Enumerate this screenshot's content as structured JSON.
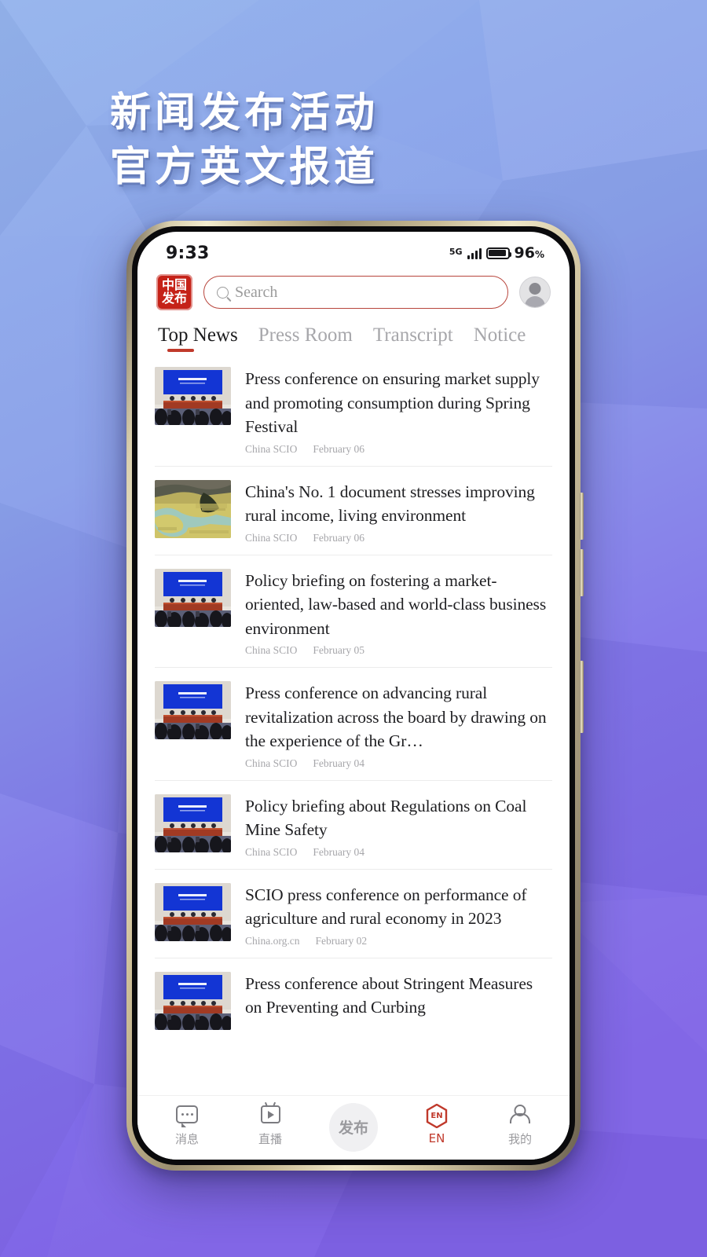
{
  "poster": {
    "headline_line1": "新闻发布活动",
    "headline_line2": "官方英文报道",
    "bg_top_color": "#8fb0ea",
    "bg_bottom_color": "#8067e6"
  },
  "status_bar": {
    "time": "9:33",
    "network": "5G",
    "battery_percent": "96",
    "percent_symbol": "%"
  },
  "header": {
    "logo_line1": "中国",
    "logo_line2": "发布",
    "search_placeholder": "Search",
    "search_value": "",
    "avatar_name": "user-avatar",
    "accent_color": "#c52218"
  },
  "tabs": [
    {
      "label": "Top News",
      "active": true
    },
    {
      "label": "Press Room",
      "active": false
    },
    {
      "label": "Transcript",
      "active": false
    },
    {
      "label": "Notice",
      "active": false
    }
  ],
  "news": [
    {
      "title": "Press conference on ensuring market supply and promoting consumption during Spring Festival",
      "source": "China SCIO",
      "date": "February 06",
      "thumb": "press-conference"
    },
    {
      "title": "China's No. 1 document stresses improving rural income, living environment",
      "source": "China SCIO",
      "date": "February 06",
      "thumb": "rural-landscape"
    },
    {
      "title": "Policy briefing on fostering a market-oriented, law-based and world-class business environment",
      "source": "China SCIO",
      "date": "February 05",
      "thumb": "press-conference"
    },
    {
      "title": "Press conference on advancing rural revitalization across the board by drawing on the experience of the Gr…",
      "source": "China SCIO",
      "date": "February 04",
      "thumb": "press-conference"
    },
    {
      "title": "Policy briefing about Regulations on Coal Mine Safety",
      "source": "China SCIO",
      "date": "February 04",
      "thumb": "press-conference"
    },
    {
      "title": "SCIO press conference on performance of agriculture and rural economy in 2023",
      "source": "China.org.cn",
      "date": "February 02",
      "thumb": "press-conference"
    },
    {
      "title": "Press conference about Stringent Measures on Preventing and Curbing",
      "source": "",
      "date": "",
      "thumb": "press-conference"
    }
  ],
  "bottom_nav": [
    {
      "label": "消息",
      "icon": "message-icon"
    },
    {
      "label": "直播",
      "icon": "live-video-icon"
    },
    {
      "label": "发布",
      "icon": "publish-button"
    },
    {
      "label": "EN",
      "icon": "en-hexagon-icon"
    },
    {
      "label": "我的",
      "icon": "person-icon"
    }
  ]
}
